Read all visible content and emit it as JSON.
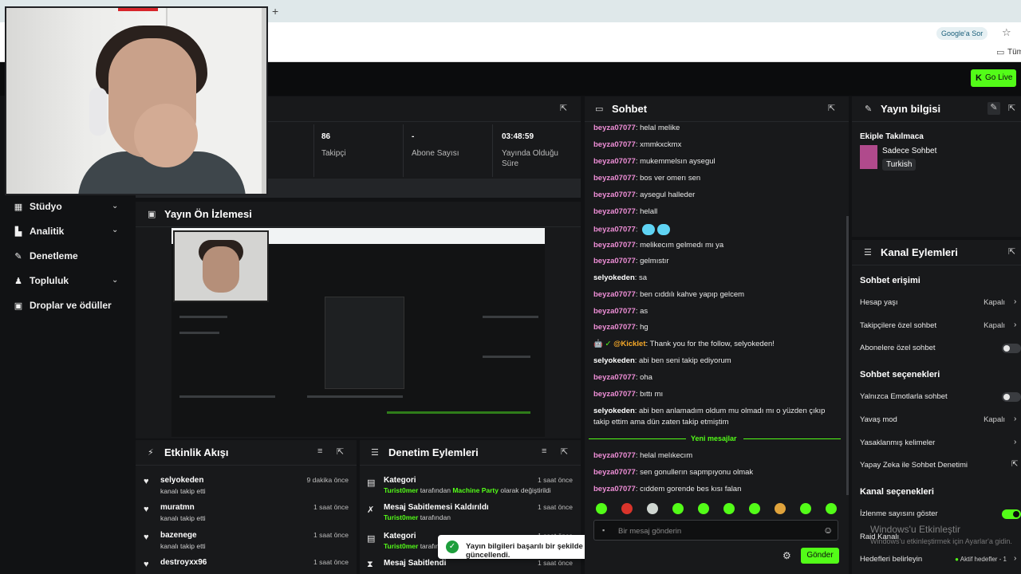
{
  "browser": {
    "new_tab_glyph": "+",
    "google_ask": "Google'a Sor",
    "bookmark_folder": "Tüm"
  },
  "topbar": {
    "go_live_label": "Go Live",
    "go_live_k": "K"
  },
  "nav": {
    "items": [
      {
        "label": "Stüdyo",
        "icon": "studio-icon",
        "chevron": true
      },
      {
        "label": "Analitik",
        "icon": "chart-icon",
        "chevron": true
      },
      {
        "label": "Denetleme",
        "icon": "wrench-icon",
        "chevron": false
      },
      {
        "label": "Topluluk",
        "icon": "community-icon",
        "chevron": true
      },
      {
        "label": "Droplar ve ödüller",
        "icon": "gift-icon",
        "chevron": false
      }
    ]
  },
  "stats": [
    {
      "value": "86",
      "label": "Takipçi"
    },
    {
      "value": "-",
      "label": "Abone Sayısı"
    },
    {
      "value": "03:48:59",
      "label": "Yayında Olduğu Süre"
    }
  ],
  "preview": {
    "title": "Yayın Ön İzlemesi"
  },
  "activity": {
    "title": "Etkinlik Akışı",
    "items": [
      {
        "name": "selyokeden",
        "sub": "kanalı takip etti",
        "time": "9 dakika önce"
      },
      {
        "name": "muratmn",
        "sub": "kanalı takip etti",
        "time": "1 saat önce"
      },
      {
        "name": "bazenege",
        "sub": "kanalı takip etti",
        "time": "1 saat önce"
      },
      {
        "name": "destroyxx96",
        "sub": "",
        "time": "1 saat önce"
      }
    ]
  },
  "moderation": {
    "title": "Denetim Eylemleri",
    "items": [
      {
        "title": "Kategori",
        "user": "Turist0mer",
        "mid": "tarafından",
        "target": "Machine Party",
        "end": "olarak değiştirildi",
        "time": "1 saat önce",
        "icon": "category-icon"
      },
      {
        "title": "Mesaj Sabitlemesi Kaldırıldı",
        "user": "Turist0mer",
        "mid": "tarafından",
        "target": "",
        "end": "",
        "time": "1 saat önce",
        "icon": "unpin-icon"
      },
      {
        "title": "Kategori",
        "user": "Turist0mer",
        "mid": "tarafın",
        "target": "",
        "end": "",
        "time": "1 saat önce",
        "icon": "category-icon"
      },
      {
        "title": "Mesaj Sabitlendi",
        "user": "",
        "mid": "",
        "target": "",
        "end": "",
        "time": "1 saat önce",
        "icon": "pin-icon"
      }
    ]
  },
  "chat": {
    "title": "Sohbet",
    "messages": [
      {
        "user": "beyza07077",
        "text": ": helal melike",
        "color": "pink"
      },
      {
        "user": "beyza07077",
        "text": ": xmmkxckmx",
        "color": "pink"
      },
      {
        "user": "beyza07077",
        "text": ": mukemmelsın aysegul",
        "color": "pink"
      },
      {
        "user": "beyza07077",
        "text": ": bos ver omerı sen",
        "color": "pink"
      },
      {
        "user": "beyza07077",
        "text": ": aysegul halleder",
        "color": "pink"
      },
      {
        "user": "beyza07077",
        "text": ": helall",
        "color": "pink"
      },
      {
        "user": "beyza07077",
        "text": ": ",
        "color": "pink"
      },
      {
        "user": "beyza07077",
        "text": ": melikecım gelmedı mı ya",
        "color": "pink"
      },
      {
        "user": "beyza07077",
        "text": ": gelmıstır",
        "color": "pink"
      },
      {
        "user": "selyokeden",
        "text": ": sa",
        "color": "white"
      },
      {
        "user": "beyza07077",
        "text": ": ben cıddılı kahve yapıp gelcem",
        "color": "pink"
      },
      {
        "user": "beyza07077",
        "text": ": as",
        "color": "pink"
      },
      {
        "user": "beyza07077",
        "text": ": hg",
        "color": "pink"
      },
      {
        "user": "@Kicklet",
        "text": ": Thank you for the follow, selyokeden!",
        "color": "orange"
      },
      {
        "user": "selyokeden",
        "text": ": abi ben seni takip ediyorum",
        "color": "white"
      },
      {
        "user": "beyza07077",
        "text": ": oha",
        "color": "pink"
      },
      {
        "user": "beyza07077",
        "text": ": bıttı mı",
        "color": "pink"
      },
      {
        "user": "selyokeden",
        "text": ": abi ben anlamadım oldum mu olmadı mı o yüzden çıkıp",
        "color": "white"
      },
      {
        "user": "",
        "text": "takip ettim ama dün zaten takip etmiştim",
        "color": "white"
      },
      {
        "user": "beyza07077",
        "text": ": helal melıkecım",
        "color": "pink"
      },
      {
        "user": "beyza07077",
        "text": ": sen gonullerın sapmpıyonu olmak",
        "color": "pink"
      },
      {
        "user": "beyza07077",
        "text": ": cıddem gorende bes kısı falan",
        "color": "pink"
      }
    ],
    "new_messages_label": "Yeni mesajlar",
    "input_placeholder": "Bir mesaj gönderin",
    "send_label": "Gönder"
  },
  "stream_info": {
    "title": "Yayın bilgisi",
    "stream_title": "Ekiple Takılmaca",
    "category": "Sadece Sohbet",
    "language": "Turkish"
  },
  "channel_actions": {
    "title": "Kanal Eylemleri",
    "section1": "Sohbet erişimi",
    "age": {
      "label": "Hesap yaşı",
      "value": "Kapalı"
    },
    "followers": {
      "label": "Takipçilere özel sohbet",
      "value": "Kapalı"
    },
    "subs": {
      "label": "Abonelere özel sohbet"
    },
    "section2": "Sohbet seçenekleri",
    "emote_only": {
      "label": "Yalnızca Emotlarla sohbet"
    },
    "slow": {
      "label": "Yavaş mod",
      "value": "Kapalı"
    },
    "banned_words": {
      "label": "Yasaklanmış kelimeler"
    },
    "ai_mod": {
      "label": "Yapay Zeka ile Sohbet Denetimi"
    },
    "section3": "Kanal seçenekleri",
    "view_count": {
      "label": "İzlenme sayısını göster"
    },
    "raid": {
      "label": "Raid Kanalı"
    },
    "goals": {
      "label": "Hedefleri belirleyin",
      "value": "Aktif hedefler - 1"
    }
  },
  "toast": {
    "text": "Yayın bilgileri başarılı bir şekilde güncellendi."
  },
  "watermark": {
    "line1": "Windows'u Etkinleştir",
    "line2": "Windows'u etkinleştirmek için Ayarlar'a gidin."
  },
  "colors": {
    "accent": "#53fc18",
    "pink_user": "#f08fd8",
    "bg": "#111214",
    "panel": "#18191b"
  }
}
